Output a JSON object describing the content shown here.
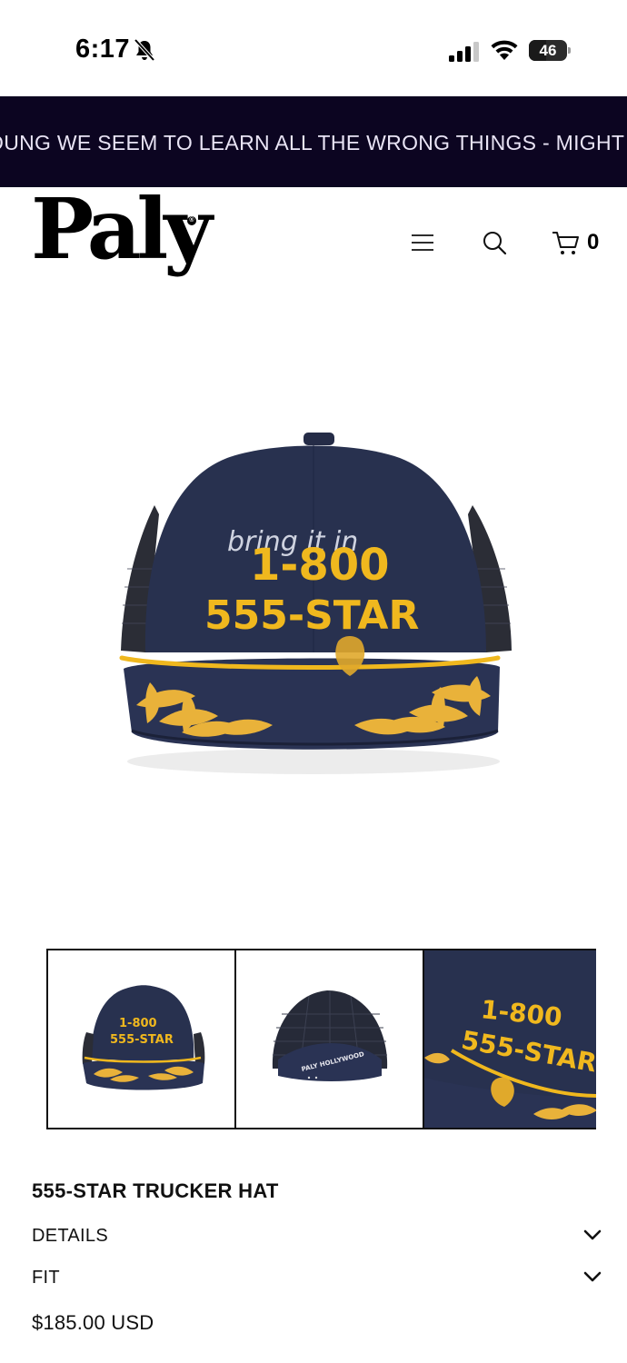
{
  "status_bar": {
    "time": "6:17",
    "battery_level": "46",
    "icons": [
      "bell-slash-icon",
      "cellular-signal-icon",
      "wifi-icon",
      "battery-icon"
    ]
  },
  "announcement": {
    "text": "OUNG WE SEEM TO LEARN ALL THE WRONG THINGS - MIGHT"
  },
  "header": {
    "logo_text": "Paly",
    "logo_mark": "®",
    "menu_icon": "hamburger-menu-icon",
    "search_icon": "search-icon",
    "cart_icon": "cart-icon",
    "cart_count": "0"
  },
  "product_image": {
    "embroidery_script": "bring it in",
    "embroidery_line_1": "1-800",
    "embroidery_line_2": "555-STAR",
    "back_label": "PALY HOLLYWOOD"
  },
  "thumbnails": [
    {
      "view": "front"
    },
    {
      "view": "back"
    },
    {
      "view": "detail"
    }
  ],
  "product": {
    "title": "555-STAR TRUCKER HAT",
    "accordion": [
      {
        "label": "DETAILS",
        "icon": "chevron-down-icon"
      },
      {
        "label": "FIT",
        "icon": "chevron-down-icon"
      }
    ],
    "price": "$185.00 USD"
  },
  "colors": {
    "marquee_bg": "#0c0521",
    "marquee_text": "#e9e4f5",
    "hat_navy": "#27304f",
    "hat_mesh": "#2a2d3a",
    "embroidery_gold": "#f0b81e"
  }
}
